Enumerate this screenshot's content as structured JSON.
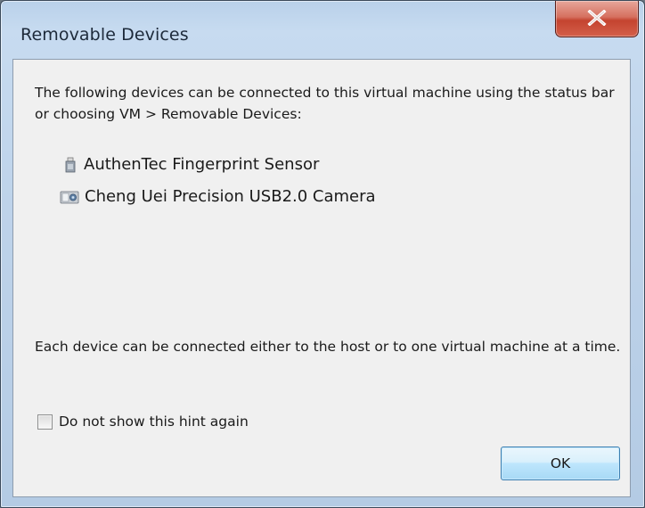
{
  "window": {
    "title": "Removable Devices",
    "close_label": "X"
  },
  "body": {
    "intro": "The following devices can be connected to this virtual machine using the status bar or choosing VM > Removable Devices:",
    "devices": [
      {
        "label": "AuthenTec Fingerprint Sensor",
        "icon": "usb-drive-icon"
      },
      {
        "label": "Cheng Uei Precision USB2.0 Camera",
        "icon": "camera-icon"
      }
    ],
    "hint": "Each device can be connected either to the host or to one virtual machine at a time.",
    "checkbox_label": "Do not show this hint again",
    "checkbox_checked": false,
    "ok_label": "OK"
  },
  "colors": {
    "close_button": "#c4432f",
    "ok_button_border": "#3c7fb1",
    "frame": "#b9d1ea"
  }
}
